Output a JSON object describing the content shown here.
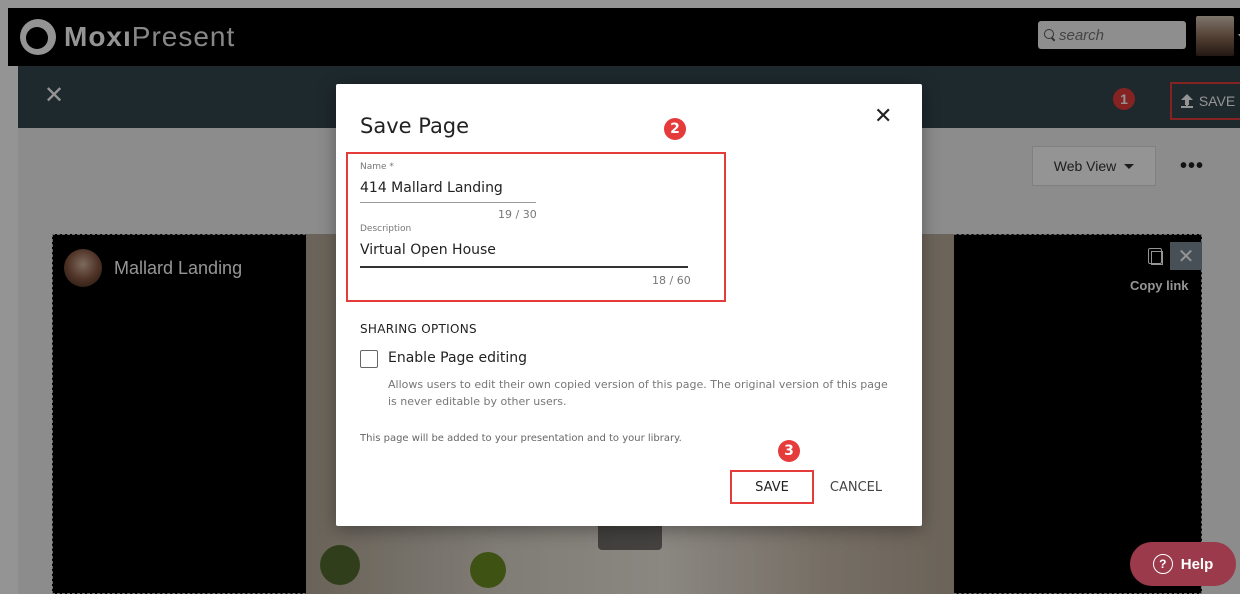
{
  "app": {
    "logo_bold": "Moxı",
    "logo_light": "Present",
    "search_placeholder": "search"
  },
  "actionbar": {
    "save_label": "SAVE"
  },
  "toolbar": {
    "view_label": "Web View",
    "more_label": "•••"
  },
  "video": {
    "title": "Mallard Landing",
    "copy_link": "Copy link"
  },
  "badges": {
    "one": "1",
    "two": "2",
    "three": "3"
  },
  "modal": {
    "title": "Save Page",
    "name_label": "Name *",
    "name_value": "414 Mallard Landing",
    "name_counter": "19 / 30",
    "description_label": "Description",
    "description_value": "Virtual Open House",
    "description_counter": "18 / 60",
    "sharing_heading": "SHARING OPTIONS",
    "enable_editing_label": "Enable Page editing",
    "enable_editing_checked": false,
    "enable_editing_help": "Allows users to edit their own copied version of this page. The original version of this page is never editable by other users.",
    "note": "This page will be added to your presentation and to your library.",
    "save_label": "SAVE",
    "cancel_label": "CANCEL"
  },
  "help": {
    "label": "Help",
    "icon_glyph": "?"
  },
  "colors": {
    "accent_red": "#e53b3b",
    "actionbar_bg": "#34474f",
    "help_bg": "#9a3a4a"
  }
}
